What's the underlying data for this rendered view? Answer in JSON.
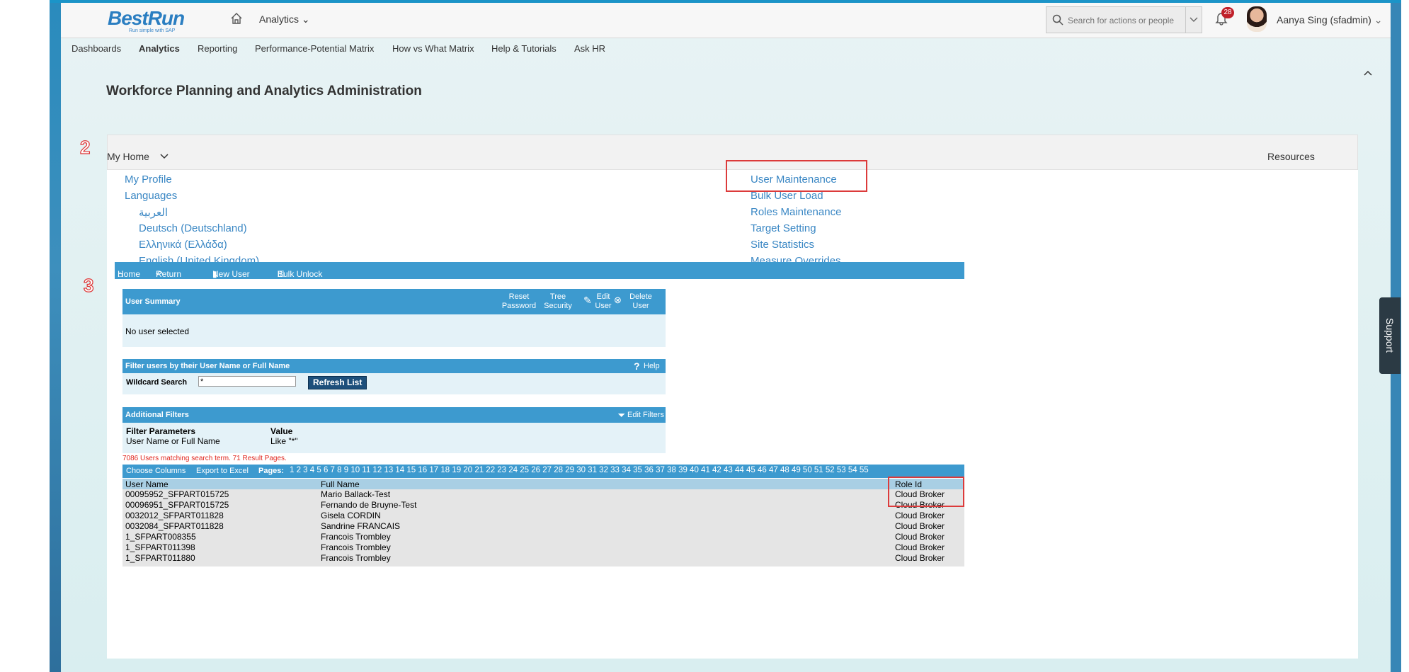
{
  "header": {
    "logo_brand": "BestRun",
    "logo_tagline": "Run simple with SAP",
    "analytics_menu": "Analytics",
    "search_placeholder": "Search for actions or people",
    "notification_count": "28",
    "user_name": "Aanya Sing (sfadmin)"
  },
  "nav": {
    "items": [
      "Dashboards",
      "Analytics",
      "Reporting",
      "Performance-Potential Matrix",
      "How vs What Matrix",
      "Help & Tutorials",
      "Ask HR"
    ],
    "active": "Analytics"
  },
  "page_title": "Workforce Planning and Analytics Administration",
  "annotations": {
    "step2": "2",
    "step3": "3"
  },
  "myhome": {
    "title": "My Home",
    "resources": "Resources",
    "left_links": [
      "My Profile",
      "Languages"
    ],
    "languages": [
      "العربية",
      "Deutsch (Deutschland)",
      "Ελληνικά (Ελλάδα)",
      "English (United Kingdom)"
    ],
    "right_links": [
      "User Maintenance",
      "Bulk User Load",
      "Roles Maintenance",
      "Target Setting",
      "Site Statistics",
      "Measure Overrides"
    ]
  },
  "legacy": {
    "toolbar": [
      "Home",
      "Return",
      "New User",
      "Bulk Unlock"
    ],
    "user_summary": {
      "title": "User Summary",
      "reset_password": "Reset Password",
      "tree_security": "Tree Security",
      "edit_user": "Edit User",
      "delete_user": "Delete User",
      "message": "No user selected"
    },
    "filter": {
      "title": "Filter users by their User Name or Full Name",
      "help": "Help",
      "wildcard_label": "Wildcard Search",
      "wildcard_value": "*",
      "refresh": "Refresh List"
    },
    "additional": {
      "title": "Additional Filters",
      "edit_filters": "Edit Filters",
      "param_header": "Filter Parameters",
      "value_header": "Value",
      "param": "User Name or Full Name",
      "value": "Like \"*\""
    },
    "result_text": "7086 Users matching search term. 71 Result Pages.",
    "pager": {
      "choose_columns": "Choose Columns",
      "export": "Export to Excel",
      "pages_label": "Pages:",
      "pages": "1 2 3 4 5 6 7 8 9 10 11 12 13 14 15 16 17 18 19 20 21 22 23 24 25 26 27 28 29 30 31 32 33 34 35 36 37 38 39 40 41 42 43 44 45 46 47 48 49 50 51 52 53 54 55"
    },
    "columns": [
      "User Name",
      "Full Name",
      "Role Id"
    ],
    "rows": [
      [
        "00095952_SFPART015725",
        "Mario Ballack-Test",
        "Cloud Broker"
      ],
      [
        "00096951_SFPART015725",
        "Fernando de Bruyne-Test",
        "Cloud Broker"
      ],
      [
        "0032012_SFPART011828",
        "Gisela CORDIN",
        "Cloud Broker"
      ],
      [
        "0032084_SFPART011828",
        "Sandrine FRANCAIS",
        "Cloud Broker"
      ],
      [
        "1_SFPART008355",
        "Francois Trombley",
        "Cloud Broker"
      ],
      [
        "1_SFPART011398",
        "Francois Trombley",
        "Cloud Broker"
      ],
      [
        "1_SFPART011880",
        "Francois Trombley",
        "Cloud Broker"
      ]
    ]
  },
  "support": "Support",
  "colors": {
    "link": "#3a87c4",
    "legacy_blue": "#3d9acf",
    "annotation_red": "#dc3b3b"
  }
}
